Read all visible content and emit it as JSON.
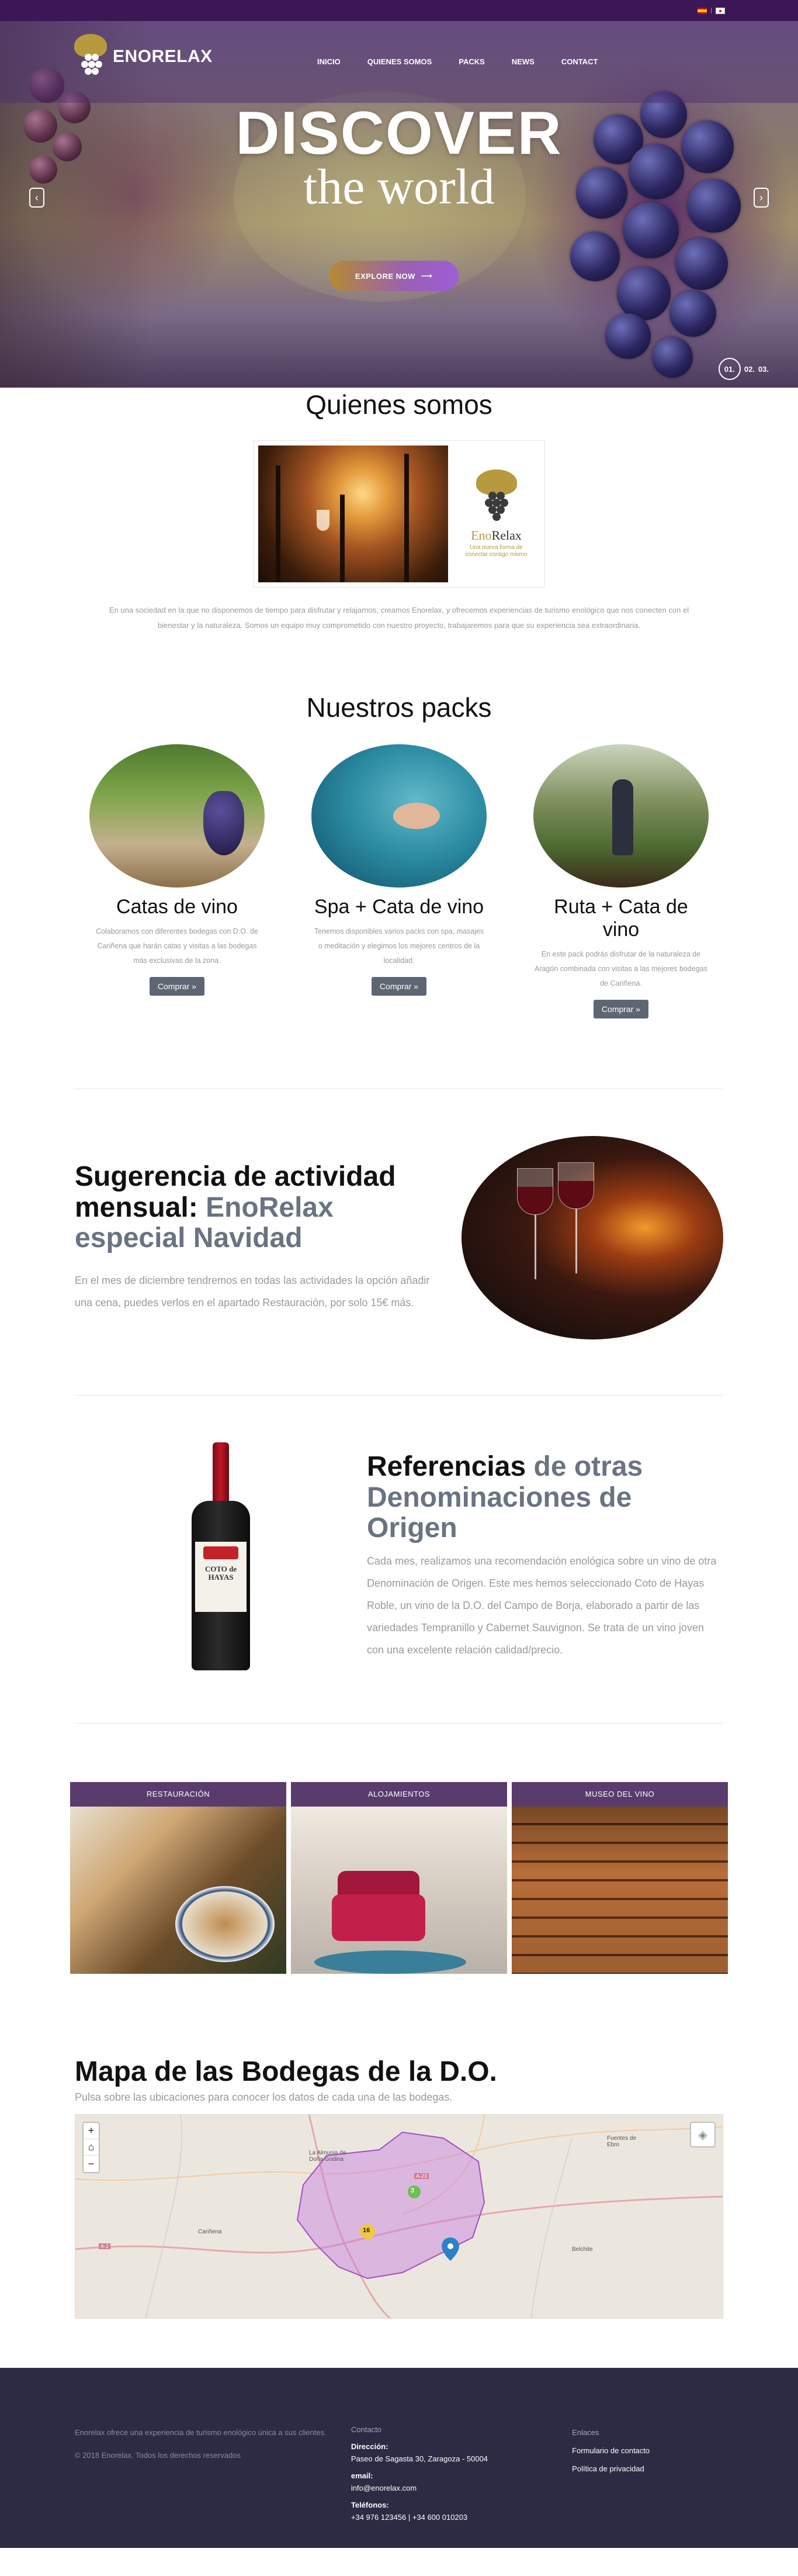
{
  "topbar": {
    "lang_es": "ES",
    "lang_en": "EN",
    "separator": "|"
  },
  "header": {
    "logo_text": "ENORELAX",
    "nav": [
      "INICIO",
      "QUIENES SOMOS",
      "PACKS",
      "NEWS",
      "CONTACT"
    ]
  },
  "hero": {
    "title": "DISCOVER",
    "subtitle": "the world",
    "cta_label": "EXPLORE NOW",
    "cta_icon": "arrow-right-icon",
    "prev_icon": "chevron-left-icon",
    "next_icon": "chevron-right-icon",
    "pager": [
      "01.",
      "02.",
      "03."
    ],
    "pager_active": "01."
  },
  "quienes": {
    "title": "Quienes somos",
    "logo_brand_1": "Eno",
    "logo_brand_2": "Relax",
    "logo_tagline": "Una nueva forma de conectar contigo mismo",
    "text": "En una sociedad en la que no disponemos de tiempo para disfrutar y relajarnos, creamos Enorelax, y ofrecemos experiencias de turismo enológico que nos conecten con el bienestar y la naturaleza. Somos un equipo muy comprometido con nuestro proyecto, trabajaremos para que su experiencia sea extraordinaria."
  },
  "packs": {
    "title": "Nuestros packs",
    "items": [
      {
        "title": "Catas de vino",
        "desc": "Colaboramos con diferentes bodegas con D.O. de Cariñena que harán catas y visitas a las bodegas más exclusivas de la zona.",
        "button": "Comprar »"
      },
      {
        "title": "Spa + Cata de vino",
        "desc": "Tenemos disponibles varios packs con spa, masajes o meditación y elegimos los mejores centros de la localidad.",
        "button": "Comprar »"
      },
      {
        "title": "Ruta + Cata de vino",
        "desc": "En este pack podrás disfrutar de la naturaleza de Aragón combinada con visitas a las mejores bodegas de Cariñena.",
        "button": "Comprar »"
      }
    ]
  },
  "sugerencia": {
    "title_main": "Sugerencia de actividad mensual: ",
    "title_muted": "EnoRelax especial Navidad",
    "desc": "En el mes de diciembre tendremos en todas las actividades la opción añadir una cena, puedes verlos en el apartado Restauración, por solo 15€ más."
  },
  "referencias": {
    "title_main": "Referencias ",
    "title_muted": "de otras Denominaciones de Origen",
    "bottle_label": "COTO de HAYAS",
    "desc": "Cada mes, realizamos una recomendación enológica sobre un vino de otra Denominación de Origen. Este mes hemos seleccionado Coto de Hayas Roble, un vino de la D.O. del Campo de Borja, elaborado a partir de las variedades Tempranillo y Cabernet Sauvignon. Se trata de un vino joven con una excelente relación calidad/precio."
  },
  "services": [
    {
      "label": "RESTAURACIÓN"
    },
    {
      "label": "ALOJAMIENTOS"
    },
    {
      "label": "MUSEO DEL VINO"
    }
  ],
  "map": {
    "title": "Mapa de las Bodegas de la D.O.",
    "subtitle": "Pulsa sobre las ubicaciones para conocer los datos de cada una de las bodegas.",
    "zoom_in": "+",
    "home": "⌂",
    "zoom_out": "−",
    "cluster_small": "3",
    "cluster_large": "16",
    "labels": [
      "La Almunia de Doña Godina",
      "Cariñena",
      "Belchite",
      "Fuentes de Ebro",
      "A-23",
      "A-2"
    ],
    "colors": {
      "region": "#c77be0",
      "marker": "#2b82cb"
    }
  },
  "footer": {
    "about": "Enorelax ofrece una experiencia de turismo enológico única a sus clientes.",
    "copyright": "©  2018 Enorelax. Todos los derechos reservados",
    "contact_head": "Contacto",
    "address_label": "Dirección:",
    "address": "Paseo de Sagasta 30, Zaragoza - 50004",
    "email_label": "email:",
    "email": "info@enorelax.com",
    "phone_label": "Teléfonos:",
    "phones": "+34 976 123456 | +34 600 010203",
    "links_head": "Enlaces",
    "links": [
      "Formulario de contacto",
      "Política de privacidad"
    ]
  },
  "colors": {
    "accent_purple": "#5a3c6c",
    "footer_bg": "#2d2b44",
    "button_gray": "#5e6673"
  }
}
